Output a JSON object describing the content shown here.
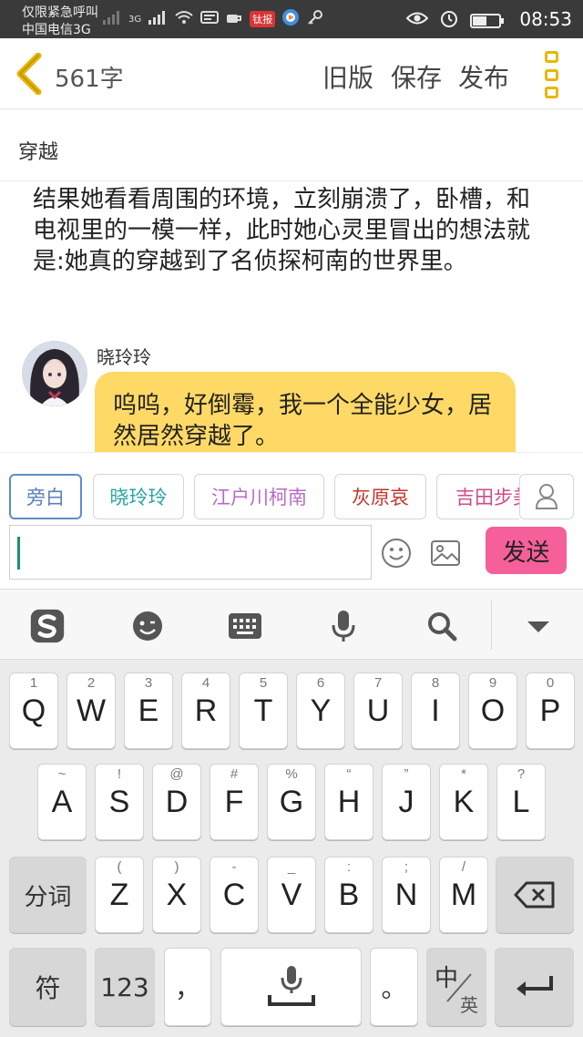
{
  "status_bar": {
    "carrier_line1": "仅限紧急呼叫",
    "carrier_line2": "中国电信3G",
    "network_label": "3G",
    "app_badge": "钛报",
    "time": "08:53",
    "battery_level": 0.5
  },
  "header": {
    "word_count": "561字",
    "old_version": "旧版",
    "save": "保存",
    "publish": "发布"
  },
  "story": {
    "title": "穿越",
    "narration": "结果她看看周围的环境，立刻崩溃了，卧槽，和电视里的一模一样，此时她心灵里冒出的想法就是:她真的穿越到了名侦探柯南的世界里。",
    "speaker_name": "晓玲玲",
    "bubble_text": "呜呜，好倒霉，我一个全能少女，居然居然穿越了。"
  },
  "characters": [
    {
      "label": "旁白",
      "color": "#5b7fb8",
      "active": true
    },
    {
      "label": "晓玲玲",
      "color": "#2aa6a0",
      "active": false
    },
    {
      "label": "江户川柯南",
      "color": "#b76bc9",
      "active": false
    },
    {
      "label": "灰原哀",
      "color": "#c0392b",
      "active": false
    },
    {
      "label": "吉田步美",
      "color": "#d14a8a",
      "active": false
    }
  ],
  "composer": {
    "input_value": "",
    "send_label": "发送"
  },
  "keyboard": {
    "row1": [
      {
        "main": "Q",
        "sub": "1"
      },
      {
        "main": "W",
        "sub": "2"
      },
      {
        "main": "E",
        "sub": "3"
      },
      {
        "main": "R",
        "sub": "4"
      },
      {
        "main": "T",
        "sub": "5"
      },
      {
        "main": "Y",
        "sub": "6"
      },
      {
        "main": "U",
        "sub": "7"
      },
      {
        "main": "I",
        "sub": "8"
      },
      {
        "main": "O",
        "sub": "9"
      },
      {
        "main": "P",
        "sub": "0"
      }
    ],
    "row2": [
      {
        "main": "A",
        "sub": "~"
      },
      {
        "main": "S",
        "sub": "!"
      },
      {
        "main": "D",
        "sub": "@"
      },
      {
        "main": "F",
        "sub": "#"
      },
      {
        "main": "G",
        "sub": "%"
      },
      {
        "main": "H",
        "sub": "“"
      },
      {
        "main": "J",
        "sub": "”"
      },
      {
        "main": "K",
        "sub": "*"
      },
      {
        "main": "L",
        "sub": "?"
      }
    ],
    "row3": [
      {
        "main": "Z",
        "sub": "("
      },
      {
        "main": "X",
        "sub": ")"
      },
      {
        "main": "C",
        "sub": "-"
      },
      {
        "main": "V",
        "sub": "_"
      },
      {
        "main": "B",
        "sub": ":"
      },
      {
        "main": "N",
        "sub": ";"
      },
      {
        "main": "M",
        "sub": "/"
      }
    ],
    "segment_key": "分词",
    "symbol_key": "符",
    "numeric_key": "123",
    "comma_key": "，",
    "period_key": "。",
    "lang_key_top": "中",
    "lang_key_bottom": "英"
  }
}
